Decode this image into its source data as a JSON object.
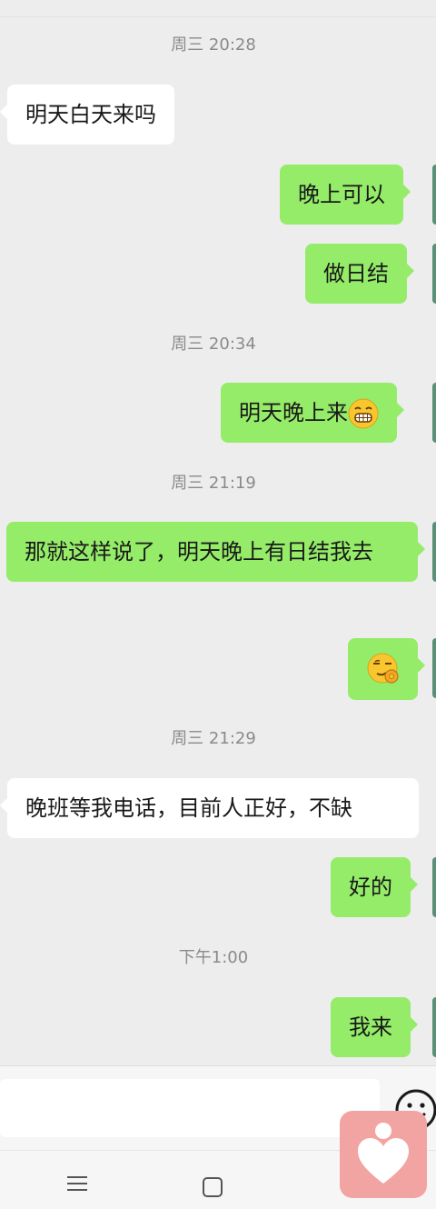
{
  "messages": [
    {
      "type": "time",
      "text": "周三 20:28"
    },
    {
      "type": "in",
      "text": "明天白天来吗"
    },
    {
      "type": "out",
      "text": "晚上可以"
    },
    {
      "type": "out",
      "text": "做日结"
    },
    {
      "type": "time",
      "text": "周三 20:34"
    },
    {
      "type": "out",
      "text": "明天晚上来",
      "emoji": "grinning-face-emoji"
    },
    {
      "type": "time",
      "text": "周三 21:19"
    },
    {
      "type": "out",
      "text": "那就这样说了，明天晚上有日结我去"
    },
    {
      "type": "out",
      "emoji": "ok-hand-smirk-emoji"
    },
    {
      "type": "time",
      "text": "周三 21:29"
    },
    {
      "type": "in",
      "text": "晚班等我电话，目前人正好，不缺"
    },
    {
      "type": "out",
      "text": "好的"
    },
    {
      "type": "time",
      "text": "下午1:00"
    },
    {
      "type": "out",
      "text": "我来"
    }
  ],
  "input": {
    "value": "",
    "emoji_button": "smiley-face-icon"
  },
  "navbar": {
    "icons": [
      "menu-icon",
      "home-icon"
    ]
  },
  "floating_app": {
    "icon": "heart-person-icon",
    "color": "#f2a4a2"
  },
  "colors": {
    "background": "#ededed",
    "out_bubble": "#95ec69",
    "in_bubble": "#ffffff"
  }
}
